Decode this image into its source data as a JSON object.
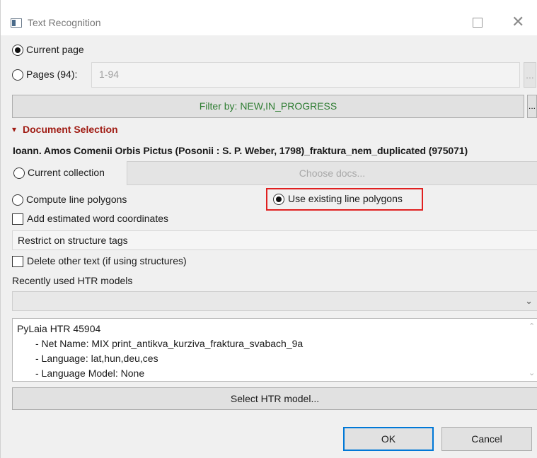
{
  "window": {
    "title": "Text Recognition"
  },
  "scope": {
    "current_page_label": "Current page",
    "pages_label": "Pages (94):",
    "pages_value": "1-94",
    "pages_more_button": "...",
    "filter_button": "Filter by: NEW,IN_PROGRESS",
    "filter_more_button": "..."
  },
  "document_selection": {
    "arrow": "▾",
    "title": "Document Selection",
    "document_name": "Ioann. Amos Comenii Orbis Pictus (Posonii : S. P. Weber, 1798)_fraktura_nem_duplicated (975071)",
    "current_collection_label": "Current collection",
    "choose_docs_button": "Choose docs..."
  },
  "options": {
    "compute_polygons_label": "Compute line polygons",
    "use_existing_polygons_label": "Use existing line polygons",
    "add_word_coords_label": "Add estimated word coordinates",
    "restrict_tags_button": "Restrict on structure tags",
    "delete_other_text_label": "Delete other text (if using structures)"
  },
  "htr": {
    "recent_models_label": "Recently used HTR models",
    "recent_models_selected": "",
    "model_name": "PyLaia HTR 45904",
    "net_name": "- Net Name: MIX print_antikva_kurziva_fraktura_svabach_9a",
    "language": "- Language: lat,hun,deu,ces",
    "language_model": "- Language Model: None",
    "select_model_button": "Select HTR model..."
  },
  "footer": {
    "ok_button": "OK",
    "cancel_button": "Cancel"
  },
  "icons": {
    "app": "app-window-icon",
    "maximize": "maximize-icon",
    "close": "close-icon",
    "dropdown": "chevron-down-icon"
  },
  "colors": {
    "section_title": "#a01c14",
    "filter_text": "#2e7d32",
    "highlight": "#e02020"
  }
}
